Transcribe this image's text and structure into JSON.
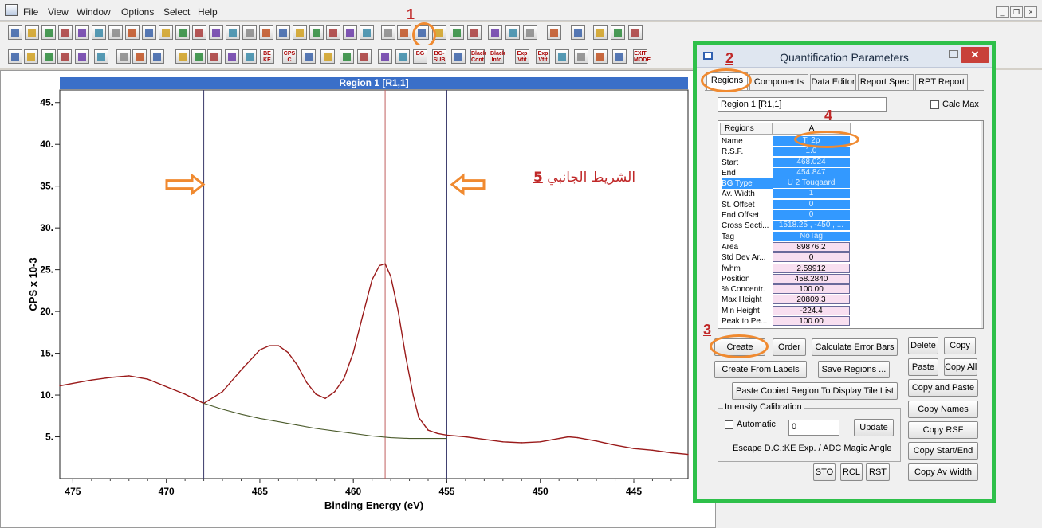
{
  "menu": {
    "items": [
      "File",
      "View",
      "Window",
      "Options",
      "Select",
      "Help"
    ]
  },
  "mdi_controls": [
    "_",
    "❒",
    "×"
  ],
  "toolbar1": {
    "step_number": "1"
  },
  "toolbar2": {
    "text_buttons": [
      "BE\nKE",
      "CPS\nC",
      "BG",
      "BG-\nSUB",
      "Black\nCont",
      "Black\nInfo",
      "Exp\nVfit",
      "Exp\nVfit",
      "EXIT\nMODE"
    ]
  },
  "plot": {
    "title": "Region 1 [R1,1]",
    "annotation_number": "5",
    "annotation_text": "الشريط الجانبي"
  },
  "chart_data": {
    "type": "line",
    "title": "Region 1 [R1,1]",
    "xlabel": "Binding Energy (eV)",
    "ylabel": "CPS x 10-3",
    "x_reversed": true,
    "xlim": [
      475.7,
      442.1
    ],
    "ylim": [
      0,
      46.5
    ],
    "x_ticks": [
      475,
      470,
      465,
      460,
      455,
      450,
      445
    ],
    "y_ticks": [
      5,
      10,
      15,
      20,
      25,
      30,
      35,
      40,
      45
    ],
    "grid": false,
    "region_lines": [
      468.0,
      455.0
    ],
    "peak_position_line": 458.3,
    "series": [
      {
        "color": "#9a1a1a",
        "x": [
          475.7,
          475,
          474,
          473,
          472,
          471,
          470,
          469,
          468,
          467,
          466,
          465,
          464.5,
          464,
          463.5,
          463,
          462.5,
          462,
          461.5,
          461,
          460.5,
          460,
          459.5,
          459,
          458.6,
          458.3,
          458,
          457.6,
          457.2,
          456.8,
          456.5,
          456,
          455.5,
          455,
          454,
          453,
          452,
          451,
          450,
          449,
          448.5,
          448,
          447,
          446,
          445,
          444,
          443,
          442.1
        ],
        "y": [
          11.1,
          11.4,
          11.8,
          12.1,
          12.3,
          11.9,
          11.0,
          10.1,
          9.0,
          10.4,
          13.0,
          15.4,
          15.9,
          15.9,
          15.1,
          13.6,
          11.5,
          10.1,
          9.6,
          10.4,
          12.0,
          15.1,
          19.5,
          23.8,
          25.5,
          25.7,
          24.2,
          20.0,
          14.6,
          10.0,
          7.3,
          5.8,
          5.4,
          5.2,
          5.0,
          4.7,
          4.4,
          4.3,
          4.4,
          4.8,
          5.0,
          4.9,
          4.5,
          4.0,
          3.6,
          3.4,
          3.1,
          2.9
        ]
      },
      {
        "color": "#4a5a2a",
        "x": [
          468.0,
          467,
          466,
          465,
          464,
          463,
          462,
          461,
          460,
          459,
          458,
          457,
          456,
          455.0
        ],
        "y": [
          9.0,
          8.3,
          7.7,
          7.2,
          6.8,
          6.4,
          6.0,
          5.7,
          5.4,
          5.1,
          4.9,
          4.8,
          4.8,
          4.8
        ]
      }
    ]
  },
  "dialog": {
    "title": "Quantification Parameters",
    "min_symbol": "–",
    "close_symbol": "✕",
    "step2": "2",
    "step3": "3",
    "step4": "4",
    "tabs": [
      "Regions",
      "Components",
      "Data Editor",
      "Report Spec.",
      "RPT Report"
    ],
    "region_field_value": "Region 1 [R1,1]",
    "calc_max_label": "Calc Max",
    "table_header_name": "Regions",
    "table_header_value": "A",
    "params": [
      {
        "name": "Name",
        "value": "Ti 2p",
        "kind": "blue"
      },
      {
        "name": "R.S.F.",
        "value": "1.0",
        "kind": "blue"
      },
      {
        "name": "Start",
        "value": "468.024",
        "kind": "blue"
      },
      {
        "name": "End",
        "value": "454.847",
        "kind": "blue"
      },
      {
        "name": "BG Type",
        "value": "U 2 Tougaard",
        "kind": "blue",
        "selected": true
      },
      {
        "name": "Av. Width",
        "value": "1",
        "kind": "blue"
      },
      {
        "name": "St. Offset",
        "value": "0",
        "kind": "blue"
      },
      {
        "name": "End Offset",
        "value": "0",
        "kind": "blue"
      },
      {
        "name": "Cross Secti...",
        "value": "1518.25 , -450 , ...",
        "kind": "blue"
      },
      {
        "name": "Tag",
        "value": "NoTag",
        "kind": "blue"
      },
      {
        "name": "Area",
        "value": "89876.2",
        "kind": "pink"
      },
      {
        "name": "Std Dev Ar...",
        "value": "0",
        "kind": "pink"
      },
      {
        "name": "fwhm",
        "value": "2.59912",
        "kind": "pink"
      },
      {
        "name": "Position",
        "value": "458.2840",
        "kind": "pink"
      },
      {
        "name": "% Concentr.",
        "value": "100.00",
        "kind": "pink"
      },
      {
        "name": "Max Height",
        "value": "20809.3",
        "kind": "pink"
      },
      {
        "name": "Min Height",
        "value": "-224.4",
        "kind": "pink"
      },
      {
        "name": "Peak to Pe...",
        "value": "100.00",
        "kind": "pink"
      }
    ],
    "buttons": {
      "create": "Create",
      "order": "Order",
      "calc_error_bars": "Calculate Error Bars",
      "delete": "Delete",
      "copy": "Copy",
      "create_from_labels": "Create From Labels",
      "save_regions": "Save Regions ...",
      "paste": "Paste",
      "copy_all": "Copy All",
      "paste_copied_region": "Paste Copied Region To Display Tile List",
      "copy_and_paste": "Copy and Paste",
      "copy_names": "Copy Names",
      "update": "Update",
      "copy_rsf": "Copy RSF",
      "copy_start_end": "Copy Start/End",
      "sto": "STO",
      "rcl": "RCL",
      "rst": "RST",
      "copy_av_width": "Copy Av Width"
    },
    "intensity": {
      "legend": "Intensity Calibration",
      "automatic_label": "Automatic",
      "value": "0",
      "escape_text": "Escape D.C.:KE Exp. / ADC Magic Angle"
    }
  }
}
